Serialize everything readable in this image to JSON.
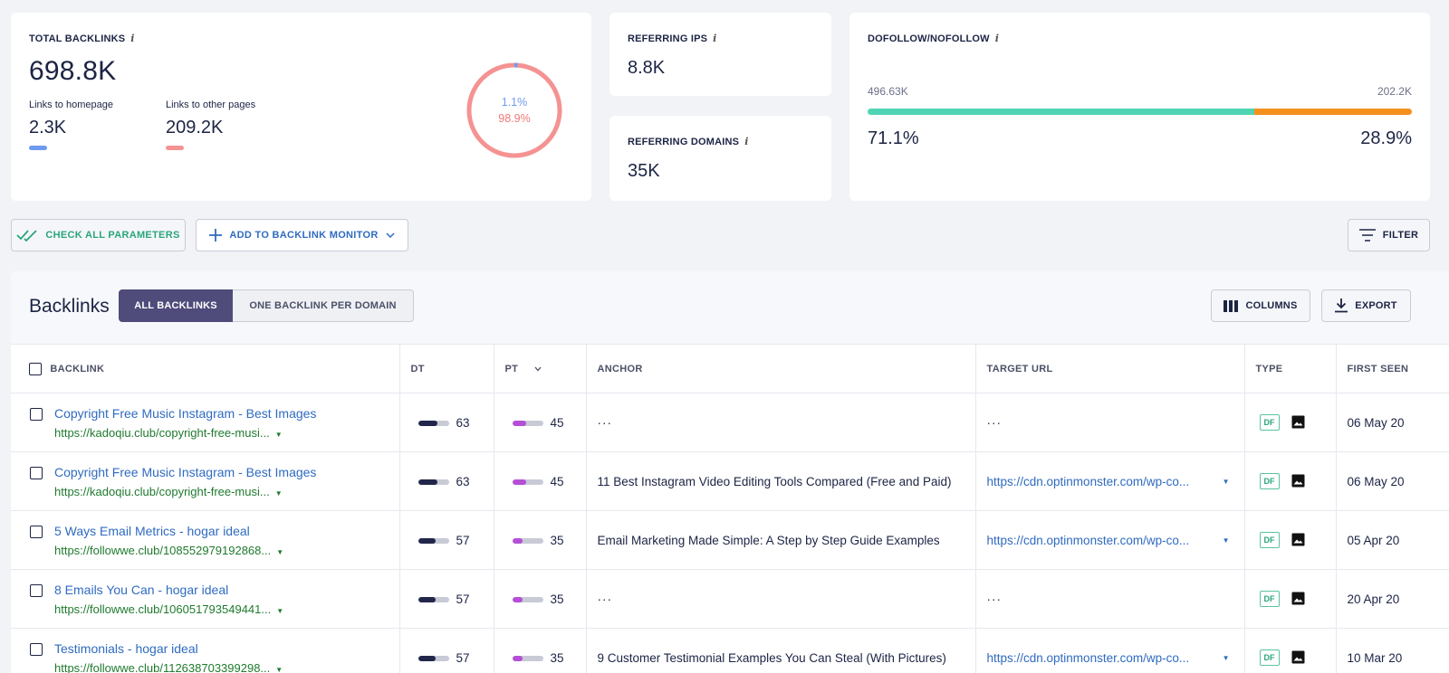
{
  "summary": {
    "total_backlinks": {
      "label": "TOTAL BACKLINKS",
      "value": "698.8K",
      "homepage_label": "Links to homepage",
      "homepage_value": "2.3K",
      "other_label": "Links to other pages",
      "other_value": "209.2K",
      "donut_homepage_pct": "1.1%",
      "donut_other_pct": "98.9%",
      "donut_fraction_homepage": 0.011,
      "color_homepage": "#6e9bf0",
      "color_other": "#f59292"
    },
    "referring_ips": {
      "label": "REFERRING IPS",
      "value": "8.8K"
    },
    "referring_domains": {
      "label": "REFERRING DOMAINS",
      "value": "35K"
    },
    "dofollow": {
      "label": "DOFOLLOW/NOFOLLOW",
      "dofollow_count": "496.63K",
      "nofollow_count": "202.2K",
      "dofollow_pct": "71.1%",
      "nofollow_pct": "28.9%",
      "dofollow_fraction": 0.711,
      "color_dofollow": "#4fd4b4",
      "color_nofollow": "#f5901e"
    },
    "info_icon": "i"
  },
  "actions": {
    "check_all": "CHECK ALL PARAMETERS",
    "add_monitor": "ADD TO BACKLINK MONITOR",
    "filter": "FILTER"
  },
  "panel": {
    "title": "Backlinks",
    "tab_all": "ALL BACKLINKS",
    "tab_one": "ONE BACKLINK PER DOMAIN",
    "columns_btn": "COLUMNS",
    "export_btn": "EXPORT"
  },
  "table": {
    "headers": {
      "backlink": "BACKLINK",
      "dt": "DT",
      "pt": "PT",
      "anchor": "ANCHOR",
      "target": "TARGET URL",
      "type": "TYPE",
      "first_seen": "FIRST SEEN"
    },
    "rows": [
      {
        "title": "Copyright Free Music Instagram - Best Images",
        "url": "https://kadoqiu.club/copyright-free-musi...",
        "dt": "63",
        "pt": "45",
        "anchor": "···",
        "target": "···",
        "type": "DF",
        "first_seen": "06 May 20"
      },
      {
        "title": "Copyright Free Music Instagram - Best Images",
        "url": "https://kadoqiu.club/copyright-free-musi...",
        "dt": "63",
        "pt": "45",
        "anchor": "11 Best Instagram Video Editing Tools Compared (Free and Paid)",
        "target": "https://cdn.optinmonster.com/wp-co...",
        "type": "DF",
        "first_seen": "06 May 20"
      },
      {
        "title": "5 Ways Email Metrics - hogar ideal",
        "url": "https://followwe.club/108552979192868...",
        "dt": "57",
        "pt": "35",
        "anchor": "Email Marketing Made Simple: A Step by Step Guide Examples",
        "target": "https://cdn.optinmonster.com/wp-co...",
        "type": "DF",
        "first_seen": "05 Apr 20"
      },
      {
        "title": "8 Emails You Can - hogar ideal",
        "url": "https://followwe.club/106051793549441...",
        "dt": "57",
        "pt": "35",
        "anchor": "···",
        "target": "···",
        "type": "DF",
        "first_seen": "20 Apr 20"
      },
      {
        "title": "Testimonials - hogar ideal",
        "url": "https://followwe.club/112638703399298...",
        "dt": "57",
        "pt": "35",
        "anchor": "9 Customer Testimonial Examples You Can Steal (With Pictures)",
        "target": "https://cdn.optinmonster.com/wp-co...",
        "type": "DF",
        "first_seen": "10 Mar 20"
      }
    ]
  }
}
